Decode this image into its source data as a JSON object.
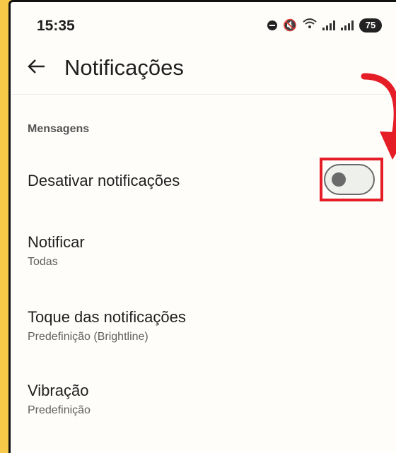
{
  "status_bar": {
    "time": "15:35",
    "battery": "75",
    "icons": [
      "do-not-disturb-icon",
      "mute-icon",
      "wifi-icon",
      "signal-icon",
      "battery-icon"
    ]
  },
  "app_bar": {
    "back_icon": "arrow-left-icon",
    "title": "Notificações"
  },
  "section": {
    "header": "Mensagens"
  },
  "settings": {
    "disable_notifications": {
      "label": "Desativar notificações",
      "toggle_on": false
    },
    "notify": {
      "label": "Notificar",
      "value": "Todas"
    },
    "ringtone": {
      "label": "Toque das notificações",
      "value": "Predefinição (Brightline)"
    },
    "vibration": {
      "label": "Vibração",
      "value": "Predefinição"
    }
  },
  "annotation": {
    "highlight_color": "#e51d27",
    "arrow_color": "#e51d27",
    "frame_color": "#f7c948"
  }
}
